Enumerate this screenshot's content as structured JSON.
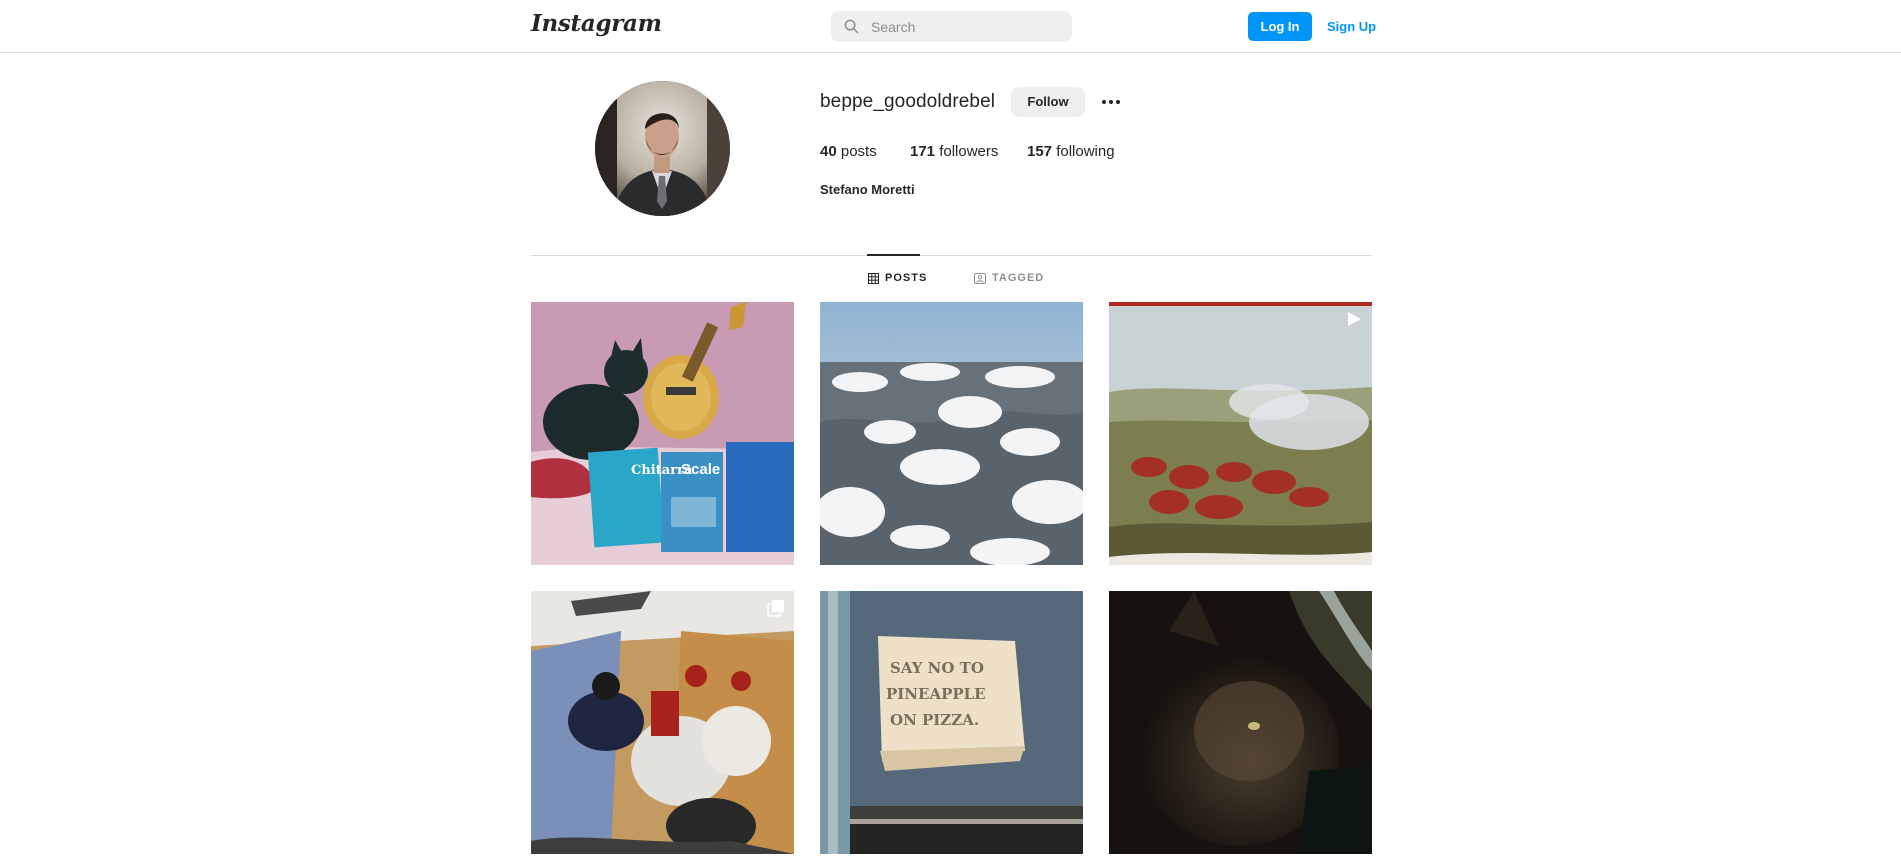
{
  "nav": {
    "logo_text": "Instagram",
    "search_placeholder": "Search",
    "search_icon": "search-icon",
    "login_label": "Log In",
    "signup_label": "Sign Up",
    "accent_color": "#0095f6"
  },
  "profile": {
    "username": "beppe_goodoldrebel",
    "follow_label": "Follow",
    "more_icon": "more-options-icon",
    "full_name": "Stefano Moretti",
    "stats": {
      "posts_count": "40",
      "posts_label": "posts",
      "followers_count": "171",
      "followers_label": "followers",
      "following_count": "157",
      "following_label": "following"
    }
  },
  "tabs": [
    {
      "label": "POSTS",
      "icon": "grid-icon",
      "active": true
    },
    {
      "label": "TAGGED",
      "icon": "tagged-icon",
      "active": false
    }
  ],
  "posts": [
    {
      "subject": "cat-guitar-music-books",
      "badge": "none",
      "printed_text": [
        "Chitarra",
        "Scale"
      ]
    },
    {
      "subject": "aerial-clouds-mountains",
      "badge": "none"
    },
    {
      "subject": "battle-painting",
      "badge": "video-icon"
    },
    {
      "subject": "cavalry-soldiers-magazine",
      "badge": "carousel-icon"
    },
    {
      "subject": "pineapple-sign",
      "badge": "none",
      "printed_text": "SAY NO TO PINEAPPLE ON PIZZA."
    },
    {
      "subject": "dark-cat-closeup",
      "badge": "none"
    }
  ]
}
